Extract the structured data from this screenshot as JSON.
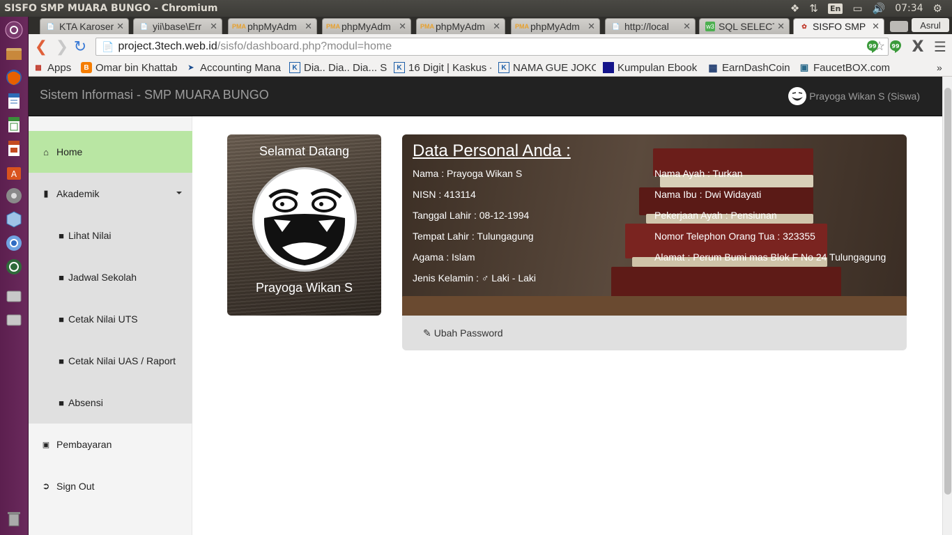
{
  "os": {
    "window_title": "SISFO SMP MUARA BUNGO - Chromium",
    "lang": "En",
    "time": "07:34"
  },
  "launcher": [
    {
      "icon": "ubuntu-dash-icon",
      "color": "#e05d2a"
    },
    {
      "icon": "files-icon",
      "color": "#a0522d"
    },
    {
      "icon": "firefox-icon",
      "color": "#e66000"
    },
    {
      "icon": "writer-icon",
      "color": "#2e6cb6"
    },
    {
      "icon": "calc-icon",
      "color": "#3a8d3a"
    },
    {
      "icon": "impress-icon",
      "color": "#c44a20"
    },
    {
      "icon": "software-center-icon",
      "color": "#d9531e"
    },
    {
      "icon": "settings-icon",
      "color": "#8a8a8a"
    },
    {
      "icon": "virtualbox-icon",
      "color": "#3c7fc0"
    },
    {
      "icon": "chromium-icon",
      "color": "#4f86c6"
    },
    {
      "icon": "updater-icon",
      "color": "#2f6a3a"
    },
    {
      "icon": "drive-icon",
      "color": "#b0b0b0"
    },
    {
      "icon": "drive-icon",
      "color": "#b0b0b0"
    },
    {
      "icon": "trash-icon",
      "color": "#8a8a8a"
    }
  ],
  "tabs": [
    {
      "title": "KTA Karoser",
      "fav": "doc"
    },
    {
      "title": "yii\\base\\Err",
      "fav": "doc"
    },
    {
      "title": "phpMyAdm",
      "fav": "pma"
    },
    {
      "title": "phpMyAdm",
      "fav": "pma"
    },
    {
      "title": "phpMyAdm",
      "fav": "pma"
    },
    {
      "title": "phpMyAdm",
      "fav": "pma"
    },
    {
      "title": "http://local",
      "fav": "doc"
    },
    {
      "title": "SQL SELECT",
      "fav": "w3"
    },
    {
      "title": "SISFO SMP I",
      "fav": "app"
    }
  ],
  "profile_name": "Asrul",
  "address": {
    "host": "project.3tech.web.id",
    "path": "/sisfo/dashboard.php?modul=home"
  },
  "bookmarks": [
    {
      "label": "Apps",
      "icon": "apps-icon",
      "color": "#c0392b"
    },
    {
      "label": "Omar bin Khattab",
      "icon": "blogger-icon",
      "color": "#f57d00"
    },
    {
      "label": "Accounting Mana",
      "icon": "arrow-icon",
      "color": "#1a4d8f"
    },
    {
      "label": "Dia.. Dia.. Dia... S",
      "icon": "kaskus-icon",
      "color": "#1d5fa8"
    },
    {
      "label": "16 Digit | Kaskus -",
      "icon": "kaskus-icon",
      "color": "#1d5fa8"
    },
    {
      "label": "NAMA GUE JOKO",
      "icon": "kaskus-icon",
      "color": "#1d5fa8"
    },
    {
      "label": "Kumpulan Ebook",
      "icon": "ebook-icon",
      "color": "#14148a"
    },
    {
      "label": "EarnDashCoin",
      "icon": "grid-icon",
      "color": "#1d3a6e"
    },
    {
      "label": "FaucetBOX.com",
      "icon": "folder-icon",
      "color": "#2a6a8a"
    }
  ],
  "app": {
    "brand": "Sistem Informasi - SMP MUARA BUNGO",
    "user": "Prayoga Wikan S (Siswa)"
  },
  "sidebar": {
    "home": "Home",
    "akademik": "Akademik",
    "sub": [
      "Lihat Nilai",
      "Jadwal Sekolah",
      "Cetak Nilai UTS",
      "Cetak Nilai UAS / Raport",
      "Absensi"
    ],
    "pembayaran": "Pembayaran",
    "signout": "Sign Out"
  },
  "welcome": {
    "title": "Selamat Datang",
    "name": "Prayoga Wikan S"
  },
  "personal": {
    "title": "Data Personal Anda :",
    "left": [
      "Nama : Prayoga Wikan S",
      "NISN : 413114",
      "Tanggal Lahir : 08-12-1994",
      "Tempat Lahir : Tulungagung",
      "Agama : Islam"
    ],
    "gender_label": "Jenis Kelamin :",
    "gender_value": "Laki - Laki",
    "right": [
      "Nama Ayah : Turkan",
      "Nama Ibu : Dwi Widayati",
      "Pekerjaan Ayah : Pensiunan",
      "Nomor Telephon Orang Tua : 323355",
      "Alamat : Perum Bumi mas Blok F No 24 Tulungagung"
    ],
    "change_password": "Ubah Password"
  }
}
